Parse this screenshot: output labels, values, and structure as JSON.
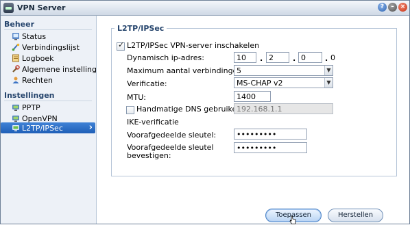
{
  "window": {
    "title": "VPN Server"
  },
  "sidebar": {
    "sections": [
      {
        "title": "Beheer",
        "items": [
          {
            "label": "Status",
            "icon": "status-icon"
          },
          {
            "label": "Verbindingslijst",
            "icon": "connection-list-icon"
          },
          {
            "label": "Logboek",
            "icon": "log-icon"
          },
          {
            "label": "Algemene instellingen",
            "icon": "general-settings-icon"
          },
          {
            "label": "Rechten",
            "icon": "privileges-icon"
          }
        ]
      },
      {
        "title": "Instellingen",
        "items": [
          {
            "label": "PPTP",
            "icon": "pptp-icon"
          },
          {
            "label": "OpenVPN",
            "icon": "openvpn-icon"
          },
          {
            "label": "L2TP/IPSec",
            "icon": "l2tp-icon",
            "selected": true
          }
        ]
      }
    ]
  },
  "main": {
    "panel_title": "L2TP/IPSec",
    "enable": {
      "label": "L2TP/IPSec VPN-server inschakelen",
      "checked": true
    },
    "dynamic_ip": {
      "label": "Dynamisch ip-adres:",
      "octets": [
        "10",
        "2",
        "0"
      ],
      "last_octet": "0"
    },
    "max_connections": {
      "label": "Maximum aantal verbindingen:",
      "value": "5"
    },
    "verification": {
      "label": "Verificatie:",
      "value": "MS-CHAP v2"
    },
    "mtu": {
      "label": "MTU:",
      "value": "1400"
    },
    "manual_dns": {
      "label": "Handmatige DNS gebruiken",
      "checked": false,
      "value": "192.168.1.1"
    },
    "ike": {
      "label": "IKE-verificatie"
    },
    "preshared_key": {
      "label": "Voorafgedeelde sleutel:",
      "value": "•••••••••"
    },
    "confirm_key": {
      "label_line1": "Voorafgedeelde sleutel",
      "label_line2": "bevestigen:",
      "value": "•••••••••"
    }
  },
  "buttons": {
    "apply": "Toepassen",
    "reset": "Herstellen"
  },
  "colors": {
    "accent": "#2a6fc9",
    "section_title": "#26456d"
  }
}
